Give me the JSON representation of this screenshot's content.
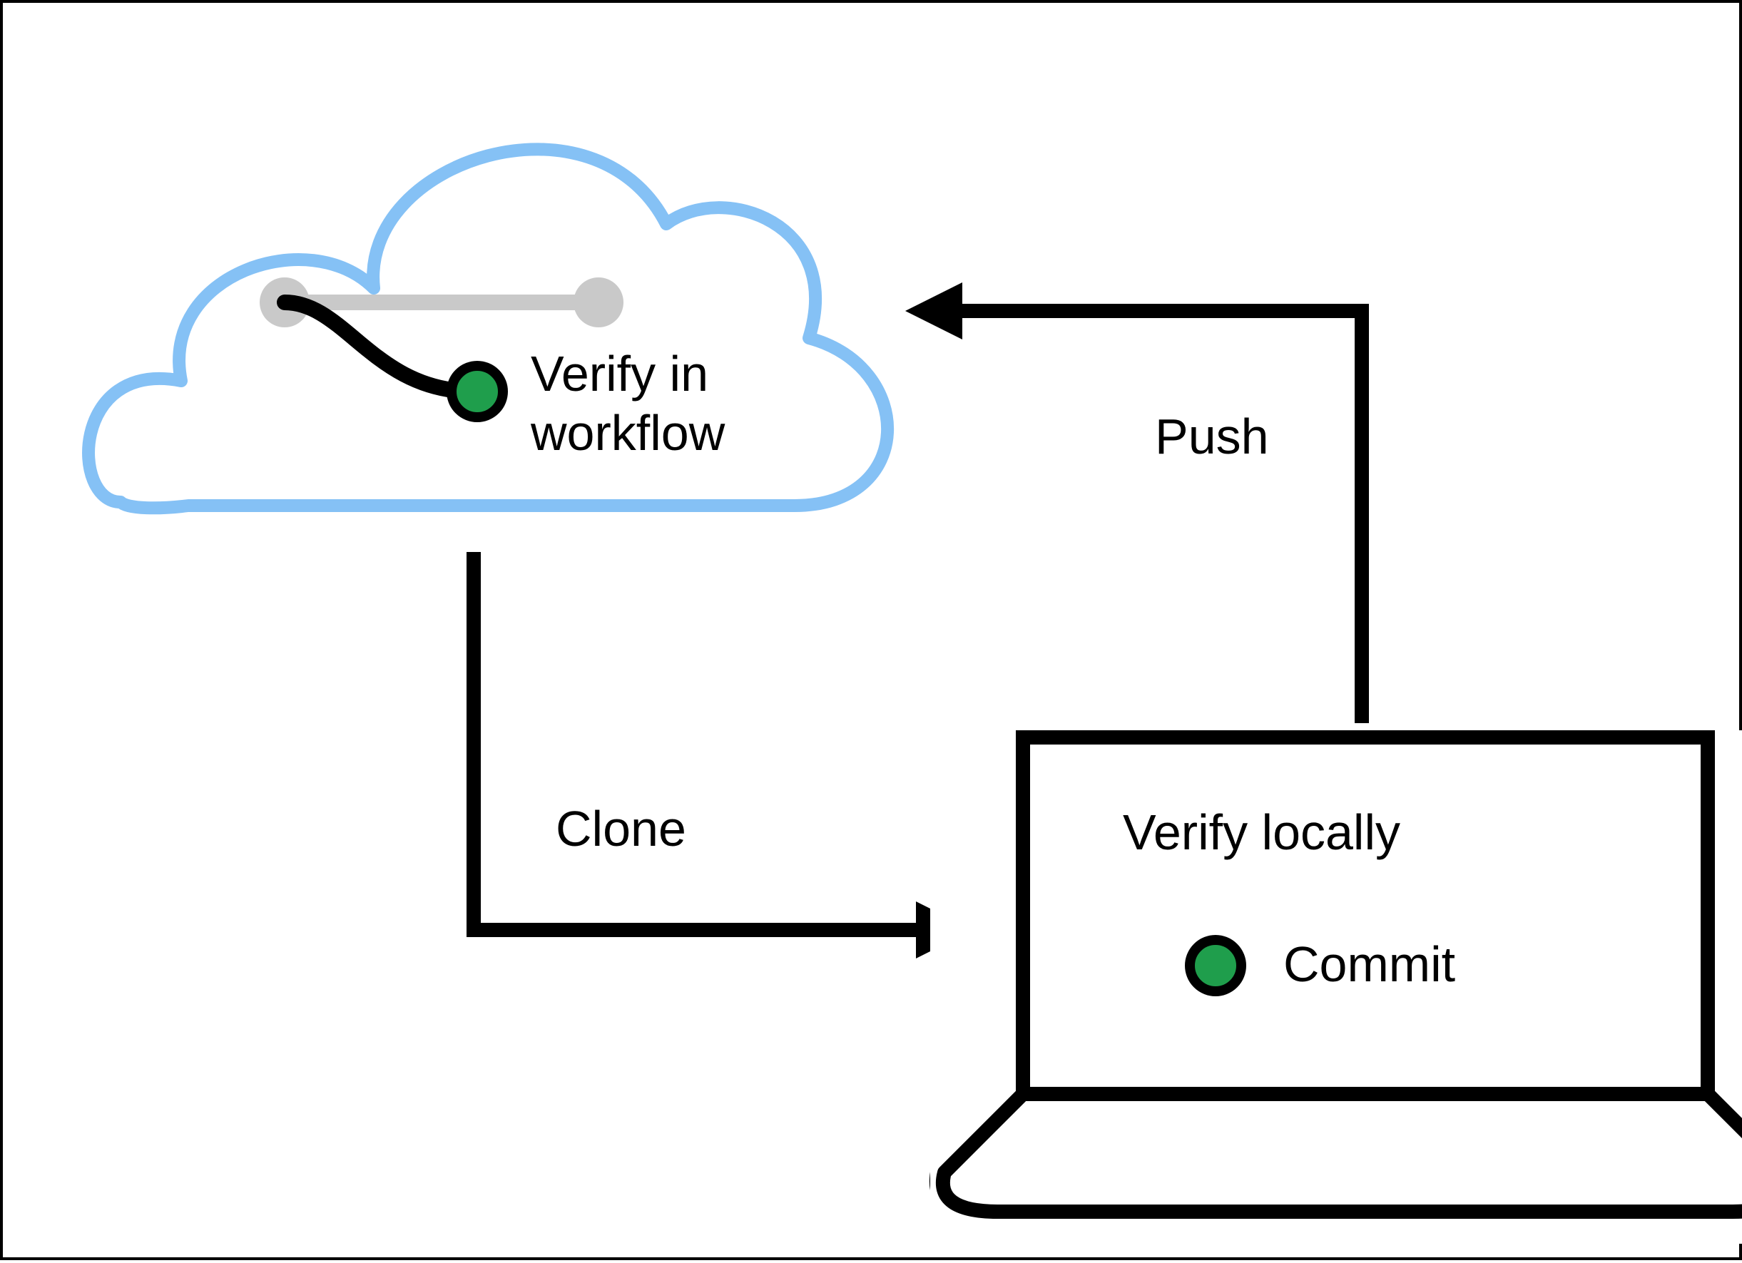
{
  "diagram": {
    "cloud": {
      "label_line1": "Verify in",
      "label_line2": "workflow"
    },
    "laptop": {
      "label_top": "Verify locally",
      "label_bottom": "Commit"
    },
    "arrows": {
      "clone": "Clone",
      "push": "Push"
    },
    "colors": {
      "cloud_outline": "#85C1F5",
      "branch_node_fill": "#1F9E4C",
      "branch_inactive": "#C9C9C9",
      "stroke": "#000000",
      "background": "#FFFFFF"
    }
  }
}
